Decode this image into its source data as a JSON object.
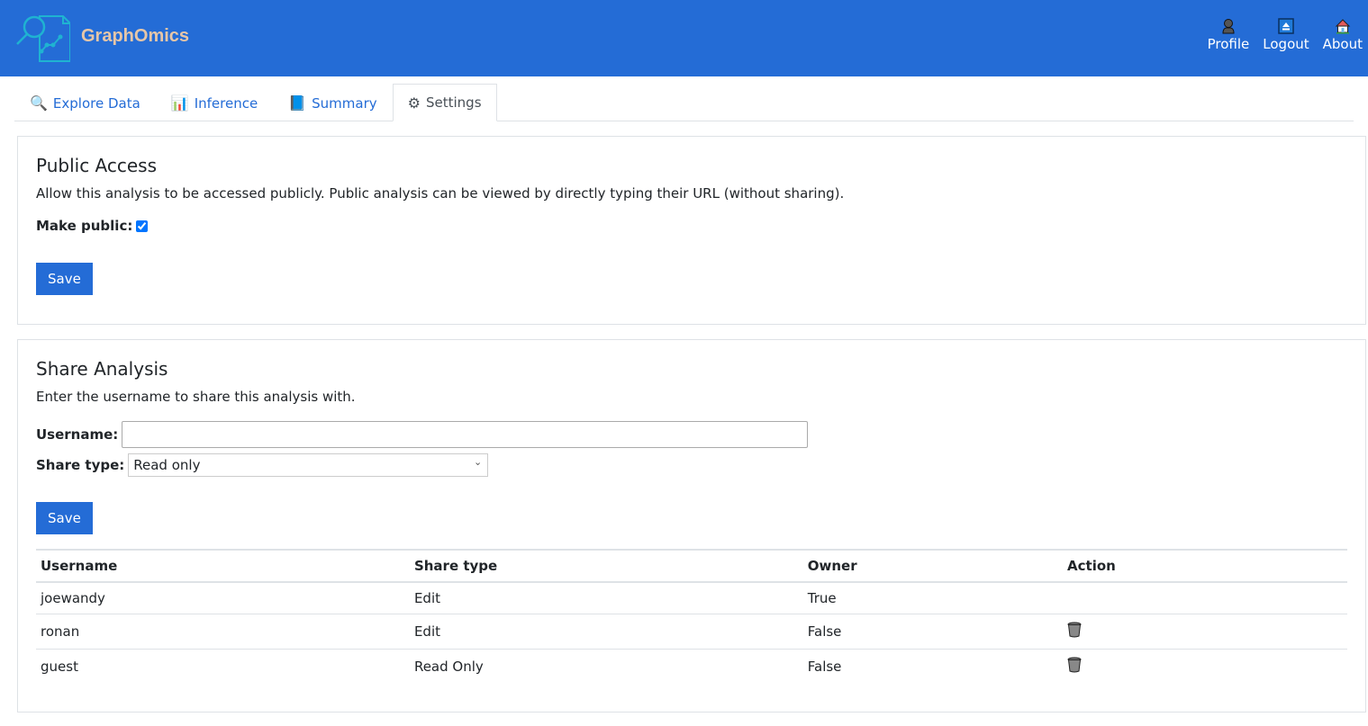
{
  "header": {
    "brand": "GraphOmics",
    "nav": [
      {
        "label": "Profile",
        "icon": "profile-icon"
      },
      {
        "label": "Logout",
        "icon": "eject-icon"
      },
      {
        "label": "About",
        "icon": "house-icon"
      }
    ]
  },
  "tabs": [
    {
      "label": "Explore Data",
      "icon": "magnifier-icon",
      "glyph": "🔍"
    },
    {
      "label": "Inference",
      "icon": "bar-chart-icon",
      "glyph": "📊"
    },
    {
      "label": "Summary",
      "icon": "book-icon",
      "glyph": "📘"
    },
    {
      "label": "Settings",
      "icon": "gear-icon",
      "glyph": "⚙",
      "active": true
    }
  ],
  "public_access": {
    "title": "Public Access",
    "description": "Allow this analysis to be accessed publicly. Public analysis can be viewed by directly typing their URL (without sharing).",
    "make_public_label": "Make public:",
    "make_public_checked": true,
    "save_label": "Save"
  },
  "share_analysis": {
    "title": "Share Analysis",
    "description": "Enter the username to share this analysis with.",
    "username_label": "Username:",
    "username_value": "",
    "share_type_label": "Share type:",
    "share_type_value": "Read only",
    "save_label": "Save",
    "table": {
      "columns": [
        "Username",
        "Share type",
        "Owner",
        "Action"
      ],
      "rows": [
        {
          "username": "joewandy",
          "share_type": "Edit",
          "owner": "True",
          "action": ""
        },
        {
          "username": "ronan",
          "share_type": "Edit",
          "owner": "False",
          "action": "delete"
        },
        {
          "username": "guest",
          "share_type": "Read Only",
          "owner": "False",
          "action": "delete"
        }
      ]
    }
  }
}
